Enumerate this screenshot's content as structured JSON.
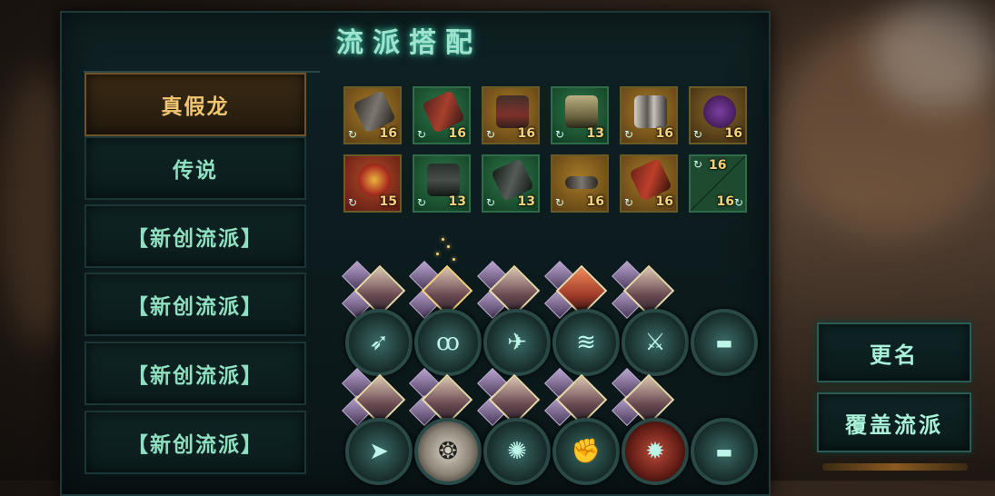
{
  "title": "流派搭配",
  "tabs": [
    {
      "label": "真假龙",
      "active": true
    },
    {
      "label": "传说",
      "active": false
    },
    {
      "label": "【新创流派】",
      "active": false
    },
    {
      "label": "【新创流派】",
      "active": false
    },
    {
      "label": "【新创流派】",
      "active": false
    },
    {
      "label": "【新创流派】",
      "active": false
    }
  ],
  "equipment_row1": [
    {
      "level": "16",
      "rarity": "gold"
    },
    {
      "level": "16",
      "rarity": "green"
    },
    {
      "level": "16",
      "rarity": "gold"
    },
    {
      "level": "13",
      "rarity": "green"
    },
    {
      "level": "16",
      "rarity": "gold"
    },
    {
      "level": "16",
      "rarity": "gold"
    }
  ],
  "equipment_row2": [
    {
      "level": "15",
      "rarity": "gold"
    },
    {
      "level": "13",
      "rarity": "green"
    },
    {
      "level": "13",
      "rarity": "green"
    },
    {
      "level": "16",
      "rarity": "gold"
    },
    {
      "level": "16",
      "rarity": "gold"
    },
    {
      "level": "16",
      "level2": "16",
      "rarity": "green"
    }
  ],
  "buttons": {
    "rename": "更名",
    "overwrite": "覆盖流派"
  },
  "colors": {
    "accent": "#9fe3cf",
    "gold": "#f2c76f",
    "level": "#f5d27a"
  }
}
